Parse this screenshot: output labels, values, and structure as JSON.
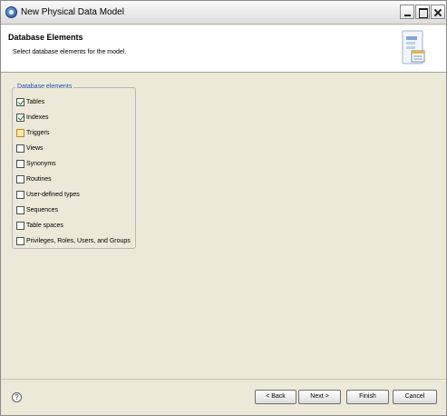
{
  "window": {
    "title": "New Physical Data Model"
  },
  "banner": {
    "title": "Database Elements",
    "subtitle": "Select database elements for the model."
  },
  "group": {
    "label": "Database elements",
    "items": [
      {
        "label": "Tables",
        "checked": true
      },
      {
        "label": "Indexes",
        "checked": true
      },
      {
        "label": "Triggers",
        "checked": false
      },
      {
        "label": "Views",
        "checked": false
      },
      {
        "label": "Synonyms",
        "checked": false
      },
      {
        "label": "Routines",
        "checked": false
      },
      {
        "label": "User-defined types",
        "checked": false
      },
      {
        "label": "Sequences",
        "checked": false
      },
      {
        "label": "Table spaces",
        "checked": false
      },
      {
        "label": "Privileges, Roles, Users, and Groups",
        "checked": false
      }
    ]
  },
  "footer": {
    "help": "?",
    "back_label": "< Back",
    "next_label": "Next >",
    "finish_label": "Finish",
    "cancel_label": "Cancel"
  }
}
